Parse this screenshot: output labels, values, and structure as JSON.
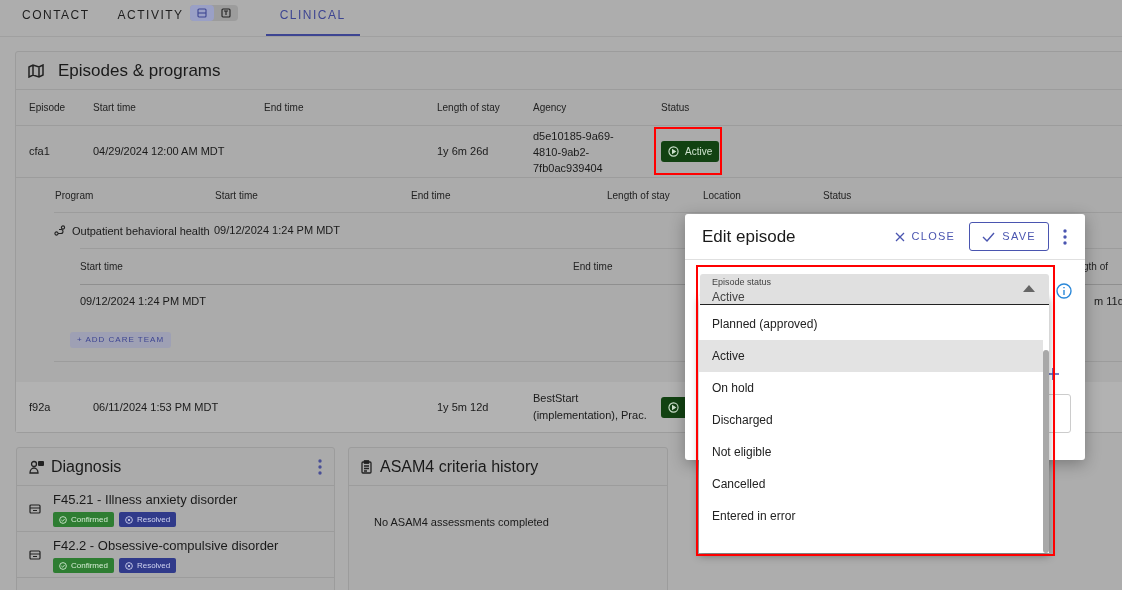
{
  "tabs": [
    {
      "label": "CONTACT",
      "selected": false
    },
    {
      "label": "ACTIVITY",
      "selected": false,
      "views": [
        {
          "selected": true
        },
        {
          "selected": false
        }
      ]
    },
    {
      "label": "CLINICAL",
      "selected": true
    }
  ],
  "episodes": {
    "title": "Episodes & programs",
    "columns": [
      "Episode",
      "Start time",
      "End time",
      "Length of stay",
      "Agency",
      "Status"
    ],
    "rows": [
      {
        "episode": "cfa1",
        "start": "04/29/2024 12:00 AM MDT",
        "los": "1y 6m 26d",
        "agency": "d5e10185-9a69-4810-9ab2-7fb0ac939404",
        "status": "Active",
        "highlighted": true
      },
      {
        "episode": "f92a",
        "start": "06/11/2024 1:53 PM MDT",
        "los": "1y 5m 12d",
        "agency": "BestStart (implementation), Prac.",
        "kind": "active"
      }
    ],
    "programs": {
      "columns": [
        "Program",
        "Start time",
        "End time",
        "Length of stay",
        "Location",
        "Status"
      ],
      "rows": [
        {
          "program": "Outpatient behavioral health",
          "start": "09/12/2024 1:24 PM MDT"
        }
      ]
    },
    "care_team": {
      "columns": [
        "Start time",
        "End time",
        "gth of"
      ],
      "rows": [
        {
          "start": "09/12/2024 1:24 PM MDT",
          "los": "m 11d"
        }
      ],
      "add_button": "+ ADD CARE TEAM"
    }
  },
  "diagnosis": {
    "title": "Diagnosis",
    "items": [
      {
        "name": "F45.21 - Illness anxiety disorder",
        "tags": [
          {
            "label": "Confirmed",
            "kind": "confirmed"
          },
          {
            "label": "Resolved",
            "kind": "resolved"
          }
        ]
      },
      {
        "name": "F42.2 - Obsessive-compulsive disorder",
        "tags": [
          {
            "label": "Confirmed",
            "kind": "confirmed"
          },
          {
            "label": "Resolved",
            "kind": "resolved"
          }
        ]
      }
    ]
  },
  "asam": {
    "title": "ASAM4 criteria history",
    "empty": "No ASAM4 assessments completed"
  },
  "dialog": {
    "title": "Edit episode",
    "close": "CLOSE",
    "save": "SAVE",
    "field": {
      "label": "Episode status",
      "value": "Active",
      "highlighted": true
    },
    "options": [
      {
        "label": "Planned (approved)",
        "selected": false
      },
      {
        "label": "Active",
        "selected": true
      },
      {
        "label": "On hold",
        "selected": false
      },
      {
        "label": "Discharged",
        "selected": false
      },
      {
        "label": "Not eligible",
        "selected": false
      },
      {
        "label": "Cancelled",
        "selected": false
      },
      {
        "label": "Entered in error",
        "selected": false
      }
    ]
  }
}
